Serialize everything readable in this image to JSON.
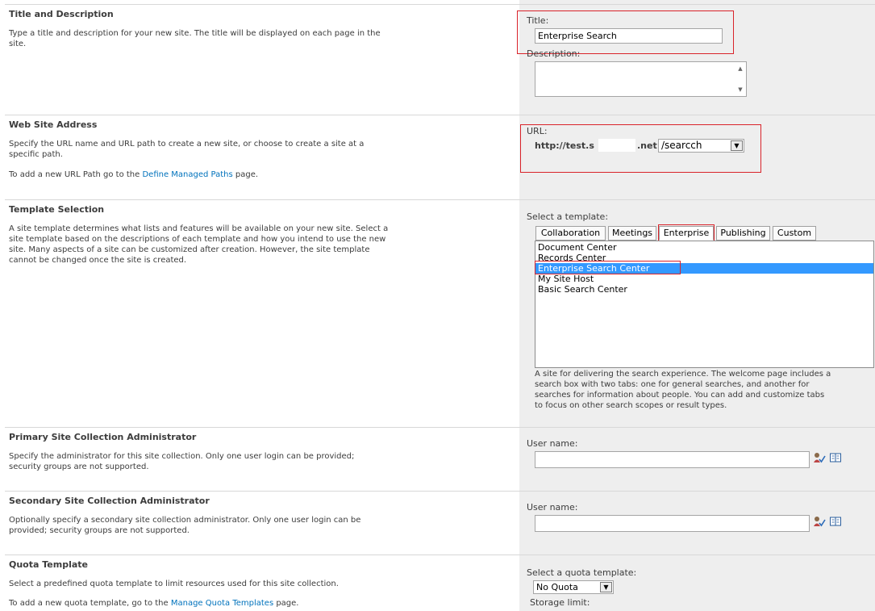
{
  "sections": {
    "title_desc": {
      "title": "Title and Description",
      "desc": "Type a title and description for your new site. The title will be displayed on each page in the site.",
      "title_label": "Title:",
      "title_value": "Enterprise Search",
      "description_label": "Description:",
      "description_value": ""
    },
    "address": {
      "title": "Web Site Address",
      "desc1": "Specify the URL name and URL path to create a new site, or choose to create a site at a specific path.",
      "desc2_prefix": "To add a new URL Path go to the ",
      "desc2_link": "Define Managed Paths",
      "desc2_suffix": " page.",
      "url_label": "URL:",
      "url_prefix_start": "http://test.s",
      "url_prefix_end": ".net",
      "url_path_value": "/searcch"
    },
    "template": {
      "title": "Template Selection",
      "desc": "A site template determines what lists and features will be available on your new site. Select a site template based on the descriptions of each template and how you intend to use the new site. Many aspects of a site can be customized after creation. However, the site template cannot be changed once the site is created.",
      "select_label": "Select a template:",
      "tabs": [
        "Collaboration",
        "Meetings",
        "Enterprise",
        "Publishing",
        "Custom"
      ],
      "active_tab": "Enterprise",
      "items": [
        "Document Center",
        "Records Center",
        "Enterprise Search Center",
        "My Site Host",
        "Basic Search Center"
      ],
      "selected_item": "Enterprise Search Center",
      "item_desc": "A site for delivering the search experience. The welcome page includes a search box with two tabs: one for general searches, and another for searches for information about people. You can add and customize tabs to focus on other search scopes or result types."
    },
    "primary_admin": {
      "title": "Primary Site Collection Administrator",
      "desc": "Specify the administrator for this site collection. Only one user login can be provided; security groups are not supported.",
      "user_label": "User name:",
      "user_value": ""
    },
    "secondary_admin": {
      "title": "Secondary Site Collection Administrator",
      "desc": "Optionally specify a secondary site collection administrator. Only one user login can be provided; security groups are not supported.",
      "user_label": "User name:",
      "user_value": ""
    },
    "quota": {
      "title": "Quota Template",
      "desc1": "Select a predefined quota template to limit resources used for this site collection.",
      "desc2_prefix": "To add a new quota template, go to the ",
      "desc2_link": "Manage Quota Templates",
      "desc2_suffix": " page.",
      "select_label": "Select a quota template:",
      "select_value": "No Quota",
      "storage_label": "Storage limit:"
    }
  },
  "colors": {
    "highlight_box": "#d9232a",
    "link": "#0072bc",
    "selection": "#3399ff",
    "right_panel": "#eeeeee"
  },
  "icons": [
    "check-names-icon",
    "browse-address-book-icon",
    "dropdown-arrow-icon",
    "scroll-up-icon",
    "scroll-down-icon"
  ]
}
